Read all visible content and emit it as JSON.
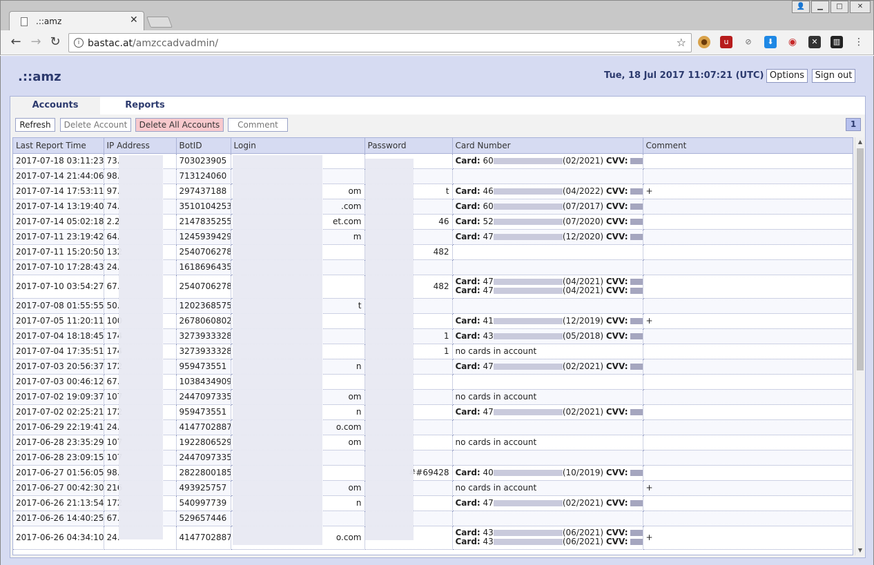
{
  "browser": {
    "tab_title": ".::amz",
    "url_host": "bastac.at",
    "url_path": "/amzccadvadmin/"
  },
  "header": {
    "logo": ".::amz",
    "datetime": "Tue, 18 Jul 2017 11:07:21 (UTC)",
    "options_label": "Options",
    "signout_label": "Sign out"
  },
  "tabs": [
    {
      "label": "Accounts"
    },
    {
      "label": "Reports"
    }
  ],
  "actions": {
    "refresh": "Refresh",
    "delete_account": "Delete Account",
    "delete_all": "Delete All Accounts",
    "comment": "Comment",
    "page": "1"
  },
  "columns": [
    "Last Report Time",
    "IP Address",
    "BotID",
    "Login",
    "Password",
    "Card Number",
    "Comment"
  ],
  "labels": {
    "card": "Card:",
    "cvv": "CVV:"
  },
  "rows": [
    {
      "time": "2017-07-18 03:11:23",
      "ip": "73.",
      "bot": "703023905",
      "login": "",
      "pass": "",
      "cards": [
        {
          "pre": "60",
          "exp": "(02/2021)"
        }
      ],
      "note": "",
      "comment": ""
    },
    {
      "time": "2017-07-14 21:44:06",
      "ip": "98.",
      "bot": "713124060",
      "login": "",
      "pass": "",
      "cards": [],
      "note": "",
      "comment": ""
    },
    {
      "time": "2017-07-14 17:53:11",
      "ip": "97.",
      "bot": "297437188",
      "login": "om",
      "pass": "t",
      "cards": [
        {
          "pre": "46",
          "exp": "(04/2022)"
        }
      ],
      "note": "",
      "comment": "+"
    },
    {
      "time": "2017-07-14 13:19:40",
      "ip": "74.",
      "bot": "3510104253",
      "login": ".com",
      "pass": "",
      "cards": [
        {
          "pre": "60",
          "exp": "(07/2017)"
        }
      ],
      "note": "",
      "comment": ""
    },
    {
      "time": "2017-07-14 05:02:18",
      "ip": "2.2",
      "bot": "2147835255",
      "login": "et.com",
      "pass": "46",
      "cards": [
        {
          "pre": "52",
          "exp": "(07/2020)"
        }
      ],
      "note": "",
      "comment": ""
    },
    {
      "time": "2017-07-11 23:19:42",
      "ip": "64.",
      "bot": "1245939429",
      "login": "m",
      "pass": "",
      "cards": [
        {
          "pre": "47",
          "exp": "(12/2020)"
        }
      ],
      "note": "",
      "comment": ""
    },
    {
      "time": "2017-07-11 15:20:50",
      "ip": "132",
      "bot": "2540706278",
      "login": "",
      "pass": "482",
      "cards": [],
      "note": "",
      "comment": ""
    },
    {
      "time": "2017-07-10 17:28:43",
      "ip": "24.",
      "bot": "1618696435",
      "login": "",
      "pass": "",
      "cards": [],
      "note": "",
      "comment": ""
    },
    {
      "time": "2017-07-10 03:54:27",
      "ip": "67.",
      "bot": "2540706278",
      "login": "",
      "pass": "482",
      "cards": [
        {
          "pre": "47",
          "exp": "(04/2021)"
        },
        {
          "pre": "47",
          "exp": "(04/2021)"
        }
      ],
      "note": "",
      "comment": ""
    },
    {
      "time": "2017-07-08 01:55:55",
      "ip": "50.",
      "bot": "1202368575",
      "login": "t",
      "pass": "",
      "cards": [],
      "note": "",
      "comment": ""
    },
    {
      "time": "2017-07-05 11:20:11",
      "ip": "100",
      "bot": "2678060802",
      "login": "",
      "pass": "",
      "cards": [
        {
          "pre": "41",
          "exp": "(12/2019)"
        }
      ],
      "note": "",
      "comment": "+"
    },
    {
      "time": "2017-07-04 18:18:45",
      "ip": "174",
      "bot": "3273933328",
      "login": "",
      "pass": "1",
      "cards": [
        {
          "pre": "43",
          "exp": "(05/2018)"
        }
      ],
      "note": "",
      "comment": ""
    },
    {
      "time": "2017-07-04 17:35:51",
      "ip": "174",
      "bot": "3273933328",
      "login": "",
      "pass": "1",
      "cards": [],
      "note": "no cards in account",
      "comment": ""
    },
    {
      "time": "2017-07-03 20:56:37",
      "ip": "172",
      "bot": "959473551",
      "login": "n",
      "pass": "",
      "cards": [
        {
          "pre": "47",
          "exp": "(02/2021)"
        }
      ],
      "note": "",
      "comment": ""
    },
    {
      "time": "2017-07-03 00:46:12",
      "ip": "67.",
      "bot": "1038434909",
      "login": "",
      "pass": "",
      "cards": [],
      "note": "",
      "comment": ""
    },
    {
      "time": "2017-07-02 19:09:37",
      "ip": "107",
      "bot": "2447097335",
      "login": "om",
      "pass": "",
      "cards": [],
      "note": "no cards in account",
      "comment": ""
    },
    {
      "time": "2017-07-02 02:25:21",
      "ip": "172",
      "bot": "959473551",
      "login": "n",
      "pass": "",
      "cards": [
        {
          "pre": "47",
          "exp": "(02/2021)"
        }
      ],
      "note": "",
      "comment": ""
    },
    {
      "time": "2017-06-29 22:19:41",
      "ip": "24.",
      "bot": "4147702887",
      "login": "o.com",
      "pass": "",
      "cards": [],
      "note": "",
      "comment": ""
    },
    {
      "time": "2017-06-28 23:35:29",
      "ip": "107",
      "bot": "1922806529",
      "login": "om",
      "pass": "",
      "cards": [],
      "note": "no cards in account",
      "comment": ""
    },
    {
      "time": "2017-06-28 23:09:15",
      "ip": "107",
      "bot": "2447097335",
      "login": "",
      "pass": "",
      "cards": [],
      "note": "",
      "comment": ""
    },
    {
      "time": "2017-06-27 01:56:05",
      "ip": "98.",
      "bot": "2822800185",
      "login": "",
      "pass": "##69428",
      "cards": [
        {
          "pre": "40",
          "exp": "(10/2019)"
        }
      ],
      "note": "",
      "comment": ""
    },
    {
      "time": "2017-06-27 00:42:30",
      "ip": "216",
      "bot": "493925757",
      "login": "om",
      "pass": "",
      "cards": [],
      "note": "no cards in account",
      "comment": "+"
    },
    {
      "time": "2017-06-26 21:13:54",
      "ip": "172",
      "bot": "540997739",
      "login": "n",
      "pass": "",
      "cards": [
        {
          "pre": "47",
          "exp": "(02/2021)"
        }
      ],
      "note": "",
      "comment": ""
    },
    {
      "time": "2017-06-26 14:40:25",
      "ip": "67.",
      "bot": "529657446",
      "login": "",
      "pass": "",
      "cards": [],
      "note": "",
      "comment": ""
    },
    {
      "time": "2017-06-26 04:34:10",
      "ip": "24.",
      "bot": "4147702887",
      "login": "o.com",
      "pass": "",
      "cards": [
        {
          "pre": "43",
          "exp": "(06/2021)"
        },
        {
          "pre": "43",
          "exp": "(06/2021)"
        }
      ],
      "note": "",
      "comment": "+"
    }
  ]
}
